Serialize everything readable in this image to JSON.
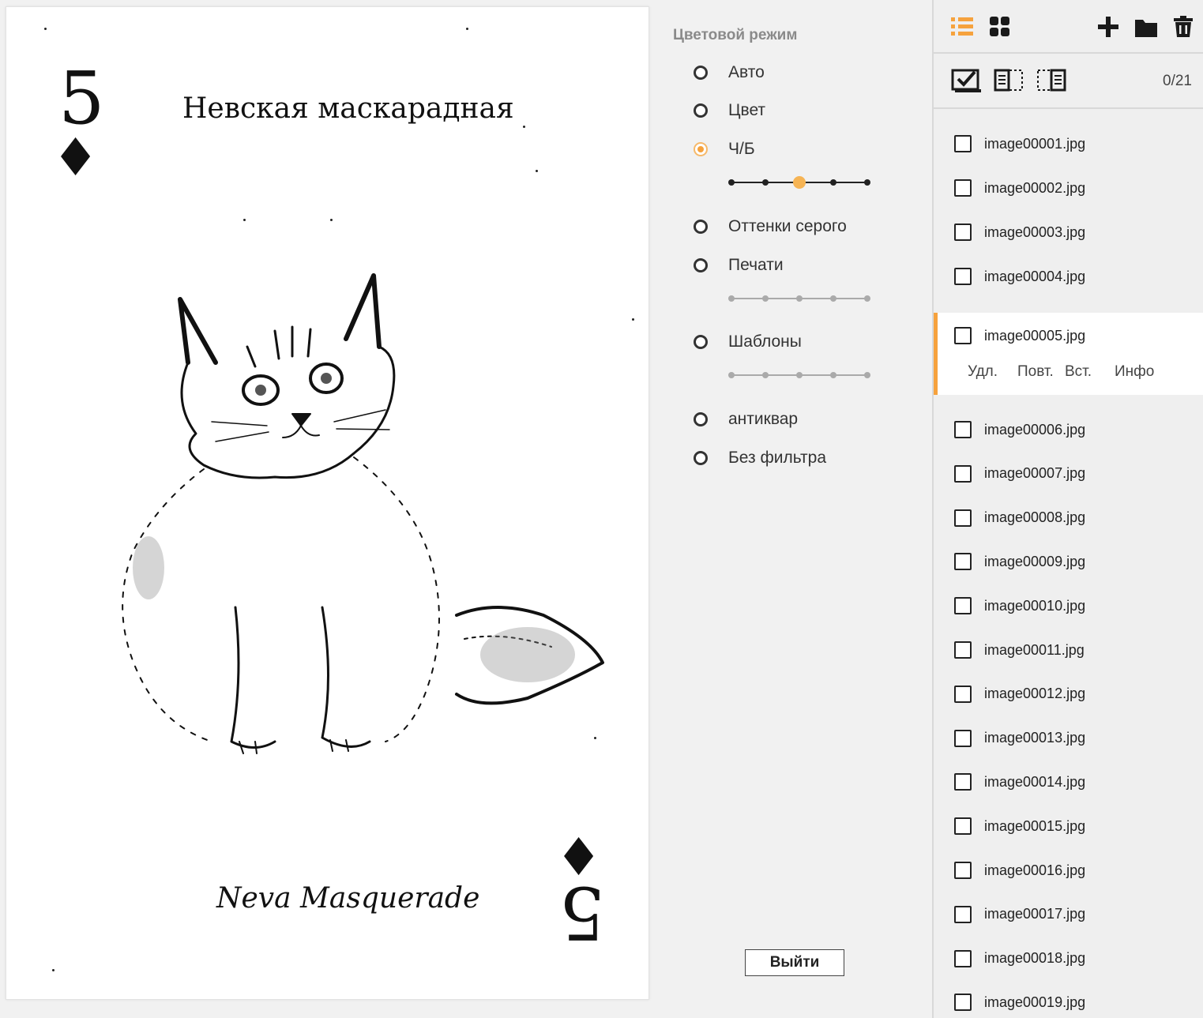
{
  "preview": {
    "card": {
      "rank": "5",
      "suit": "♦",
      "title_ru": "Невская маскарадная",
      "title_en": "Neva Masquerade"
    }
  },
  "mode_panel": {
    "title": "Цветовой режим",
    "options": [
      {
        "label": "Авто",
        "checked": false
      },
      {
        "label": "Цвет",
        "checked": false
      },
      {
        "label": "Ч/Б",
        "checked": true
      },
      {
        "label": "Оттенки серого",
        "checked": false
      },
      {
        "label": "Печати",
        "checked": false
      },
      {
        "label": "Шаблоны",
        "checked": false
      },
      {
        "label": "антиквар",
        "checked": false
      },
      {
        "label": "Без фильтра",
        "checked": false
      }
    ],
    "bw_slider": {
      "steps": 5,
      "value_index": 2
    },
    "print_slider": {
      "steps": 5
    },
    "template_slider": {
      "steps": 5
    },
    "exit_label": "Выйти"
  },
  "file_panel": {
    "icons": {
      "list_view": "list-view-icon",
      "grid_view": "grid-view-icon",
      "add": "plus-icon",
      "folder": "folder-icon",
      "delete": "trash-icon",
      "select_all": "select-all-icon",
      "select_left": "select-left-icon",
      "select_right": "select-right-icon"
    },
    "accent_color": "#f6a23d",
    "count": "0/21",
    "files_before": [
      "image00001.jpg",
      "image00002.jpg",
      "image00003.jpg",
      "image00004.jpg"
    ],
    "selected": {
      "name": "image00005.jpg",
      "actions": {
        "delete": "Удл.",
        "repeat": "Повт.",
        "insert": "Вст.",
        "info": "Инфо"
      }
    },
    "files_after": [
      "image00006.jpg",
      "image00007.jpg",
      "image00008.jpg",
      "image00009.jpg",
      "image00010.jpg",
      "image00011.jpg",
      "image00012.jpg",
      "image00013.jpg",
      "image00014.jpg",
      "image00015.jpg",
      "image00016.jpg",
      "image00017.jpg",
      "image00018.jpg",
      "image00019.jpg"
    ]
  }
}
